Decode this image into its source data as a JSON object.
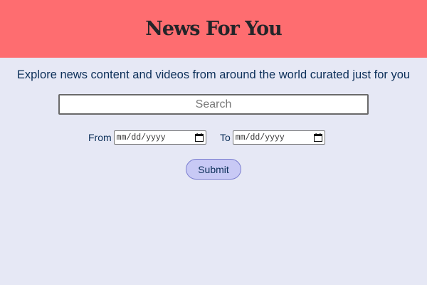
{
  "header": {
    "title": "News For You",
    "color": "#fe6d70"
  },
  "subtitle": "Explore news content and videos from around the world curated just for you",
  "search": {
    "placeholder": "Search",
    "value": ""
  },
  "date_range": {
    "from_label": "From",
    "from_placeholder": "mm/dd/yyyy",
    "to_label": "To",
    "to_placeholder": "mm/dd/yyyy",
    "icon": "calendar-icon"
  },
  "submit_label": "Submit",
  "colors": {
    "background": "#e6e8f5",
    "text": "#0c2f59",
    "button": "#c8c9f5"
  }
}
